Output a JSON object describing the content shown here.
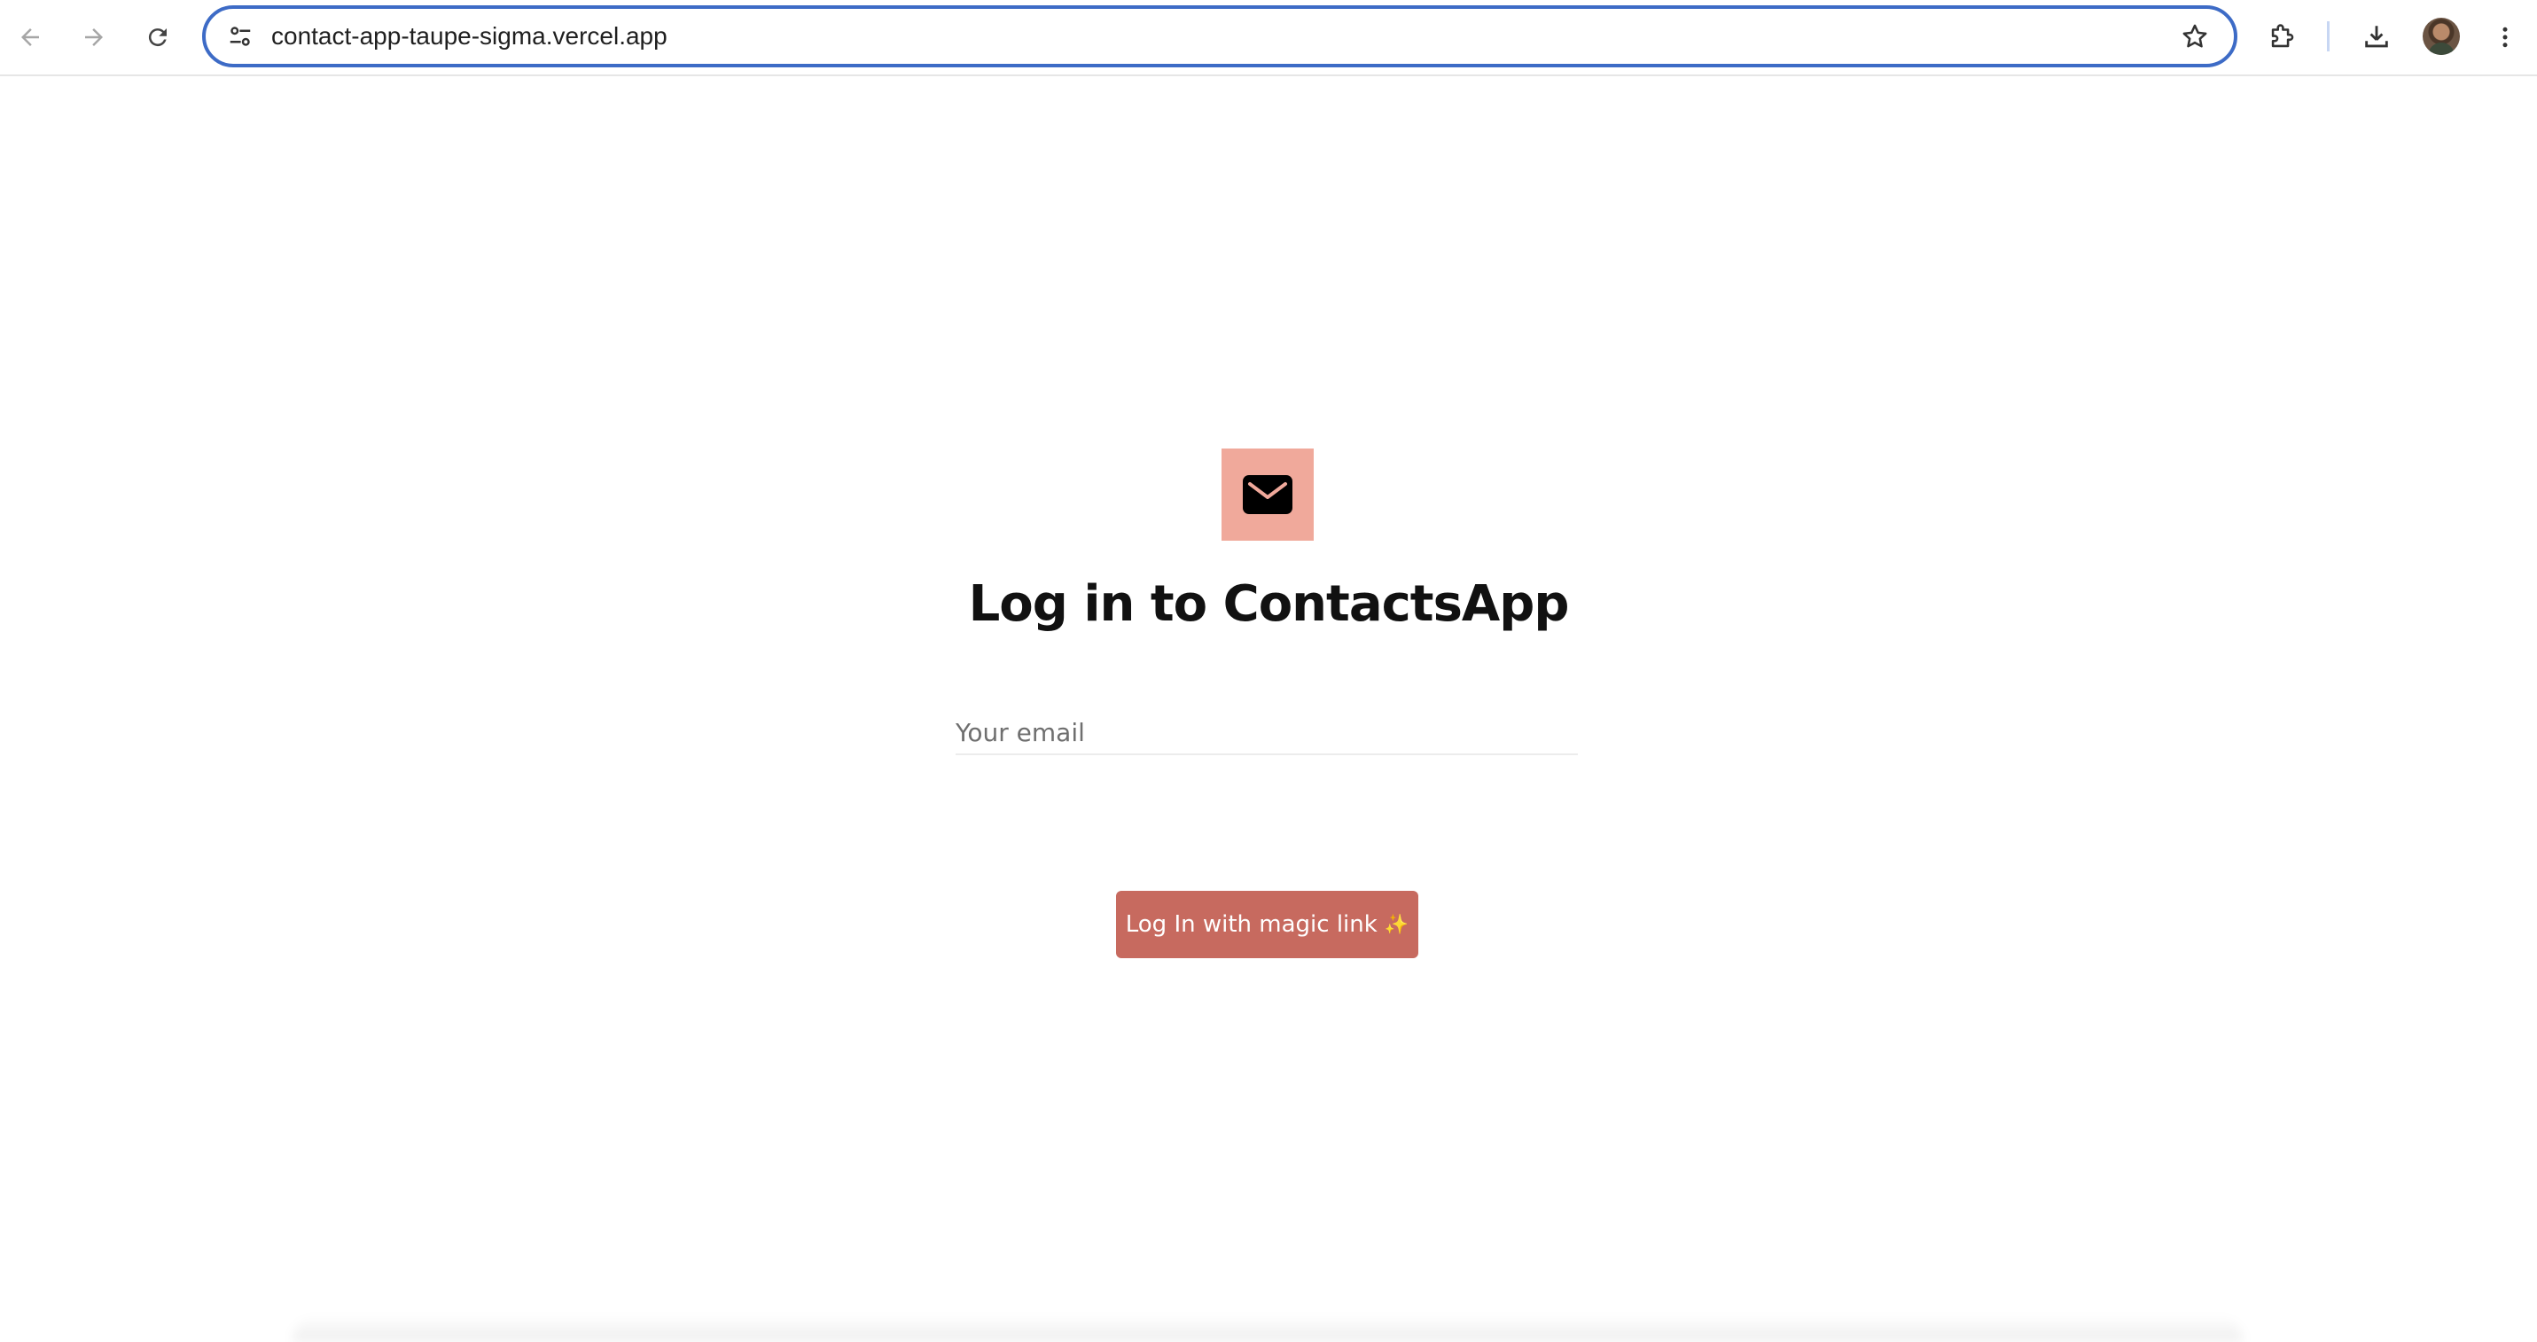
{
  "browser": {
    "url": "contact-app-taupe-sigma.vercel.app",
    "back_icon": "arrow-left-icon",
    "forward_icon": "arrow-right-icon",
    "reload_icon": "reload-icon",
    "site_info_icon": "tune-icon",
    "bookmark_icon": "star-icon",
    "extensions_icon": "puzzle-icon",
    "downloads_icon": "download-icon",
    "menu_icon": "vertical-dots-icon",
    "accent_color": "#3d6bc6"
  },
  "login": {
    "logo_icon": "envelope-icon",
    "logo_bg_color": "#f0a99b",
    "title": "Log in to ContactsApp",
    "email_placeholder": "Your email",
    "email_value": "",
    "button_label": "Log In with magic link",
    "button_emoji": "✨",
    "button_color": "#c76a5f"
  }
}
